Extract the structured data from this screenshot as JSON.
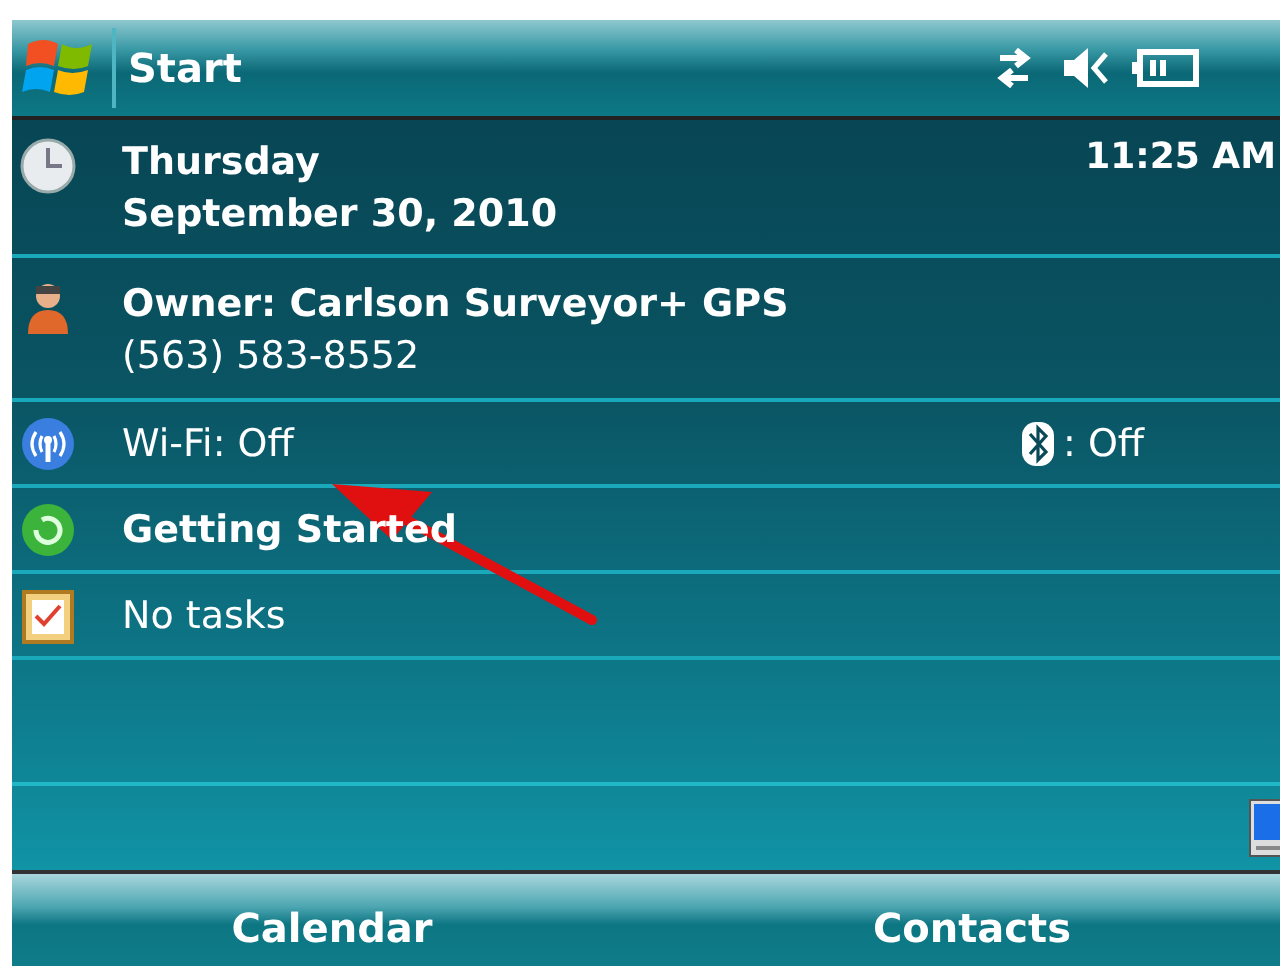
{
  "title_bar": {
    "title": "Start"
  },
  "today": {
    "day": "Thursday",
    "date": "September 30, 2010",
    "time": "11:25 AM"
  },
  "owner": {
    "name": "Owner: Carlson Surveyor+ GPS",
    "phone": "(563) 583-8552"
  },
  "wireless": {
    "wifi": "Wi-Fi: Off",
    "bluetooth": ": Off"
  },
  "items": [
    {
      "kind": "getting-started",
      "label": "Getting Started"
    },
    {
      "kind": "tasks",
      "label": "No tasks"
    }
  ],
  "soft_keys": [
    "Calendar",
    "Contacts"
  ]
}
